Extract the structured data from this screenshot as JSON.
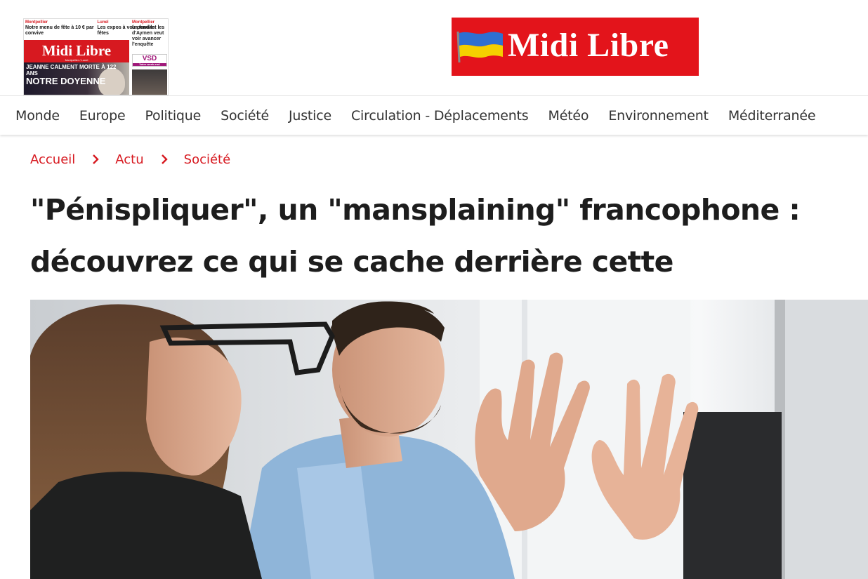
{
  "header": {
    "logo_text": "Midi Libre",
    "newspaper_thumb": {
      "masthead": "Midi Libre",
      "masthead_sub": "Montpellier / Lunel",
      "col1_city": "Montpellier",
      "col1_text": "Notre menu de fête à 10 € par convive",
      "col2_city": "Lunel",
      "col2_text": "Les expos à voir pendant les fêtes",
      "right_city": "Montpellier",
      "right_text": "La famille d'Aymen veut voir avancer l'enquête",
      "vsd": "VSD",
      "vsd_sub": "Votre week-end",
      "headline_top": "JEANNE CALMENT MORTE À 122 ANS",
      "headline_big": "NOTRE DOYENNE"
    }
  },
  "nav": {
    "items": [
      "Monde",
      "Europe",
      "Politique",
      "Société",
      "Justice",
      "Circulation - Déplacements",
      "Météo",
      "Environnement",
      "Méditerranée"
    ]
  },
  "breadcrumb": {
    "items": [
      "Accueil",
      "Actu",
      "Société"
    ]
  },
  "article": {
    "title": "\"Pénispliquer\", un \"mansplaining\" francophone : découvrez ce qui se cache derrière cette expression"
  },
  "colors": {
    "brand_red": "#e3141b",
    "breadcrumb_red": "#d71920",
    "text": "#1d1d1d"
  },
  "icons": {
    "breadcrumb_separator": "chevron-right-icon",
    "flag": "ukraine-flag-icon"
  }
}
